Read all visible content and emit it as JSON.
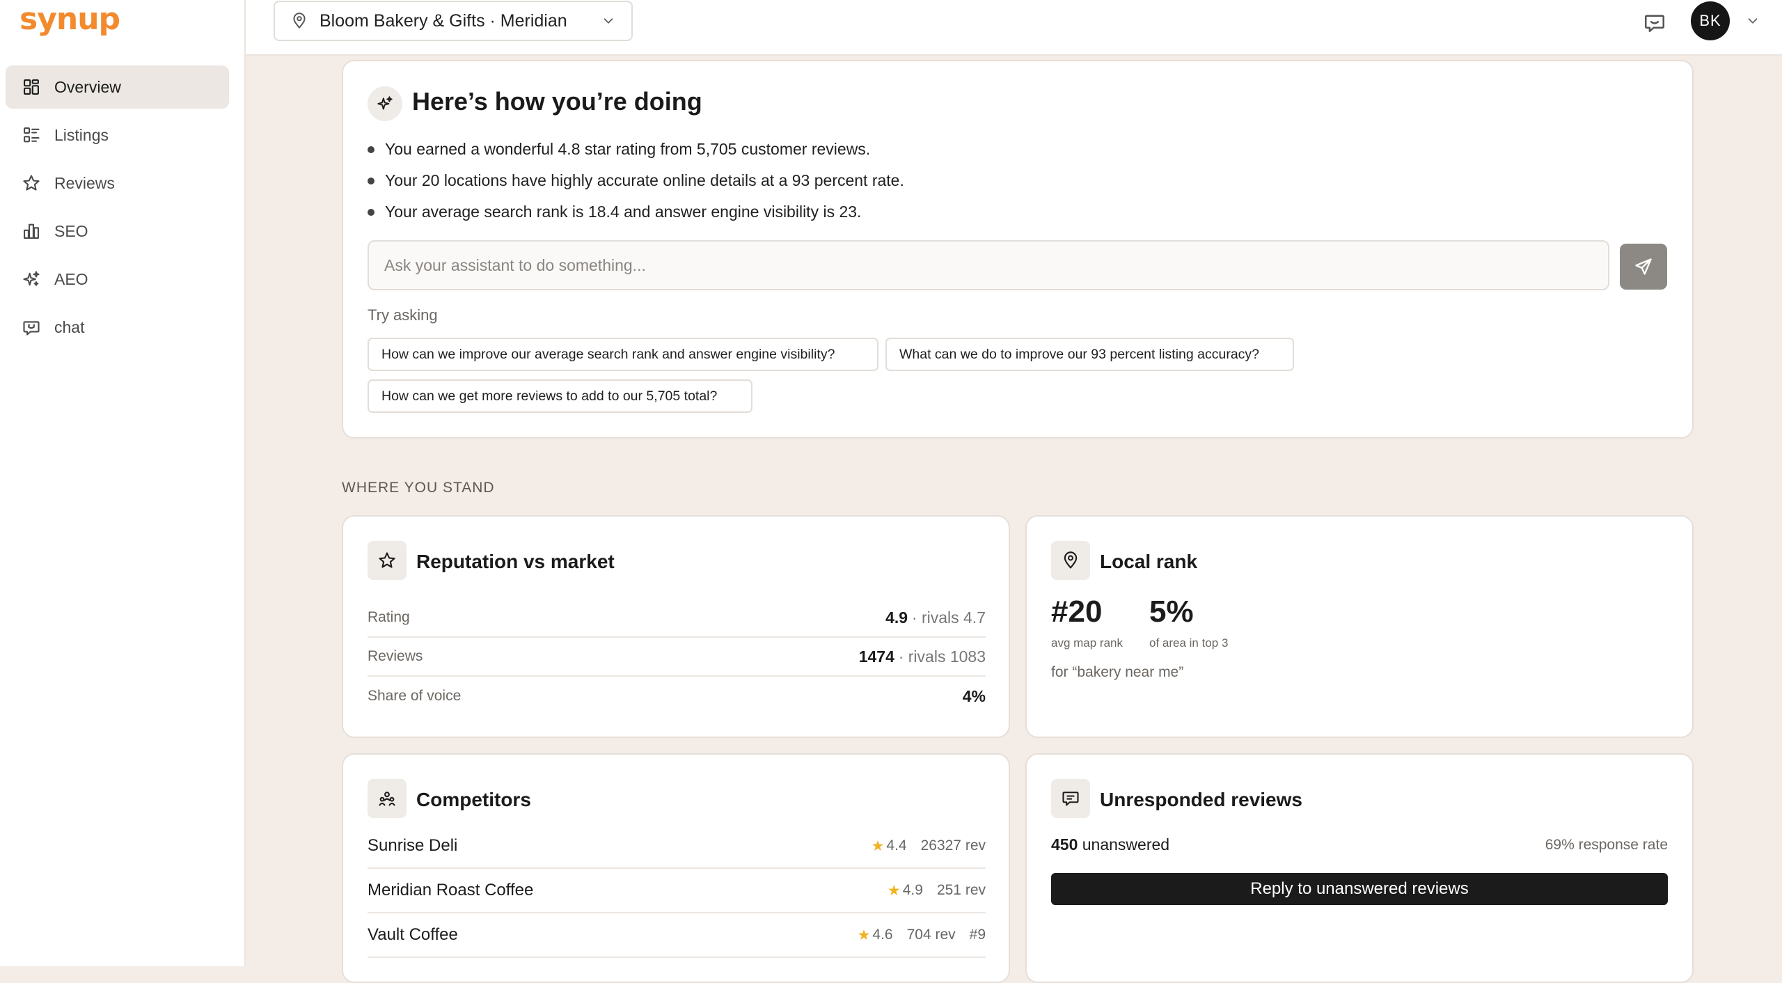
{
  "brand": {
    "logo_text": "synup",
    "accent_color": "#f28a2e"
  },
  "sidebar": {
    "items": [
      {
        "label": "Overview",
        "icon": "grid-icon",
        "active": true
      },
      {
        "label": "Listings",
        "icon": "list-icon",
        "active": false
      },
      {
        "label": "Reviews",
        "icon": "star-icon",
        "active": false
      },
      {
        "label": "SEO",
        "icon": "bar-chart-icon",
        "active": false
      },
      {
        "label": "AEO",
        "icon": "sparkle-icon",
        "active": false
      },
      {
        "label": "chat",
        "icon": "chat-icon",
        "active": false
      }
    ]
  },
  "topbar": {
    "location": "Bloom Bakery & Gifts · Meridian",
    "avatar_initials": "BK"
  },
  "summary": {
    "title": "Here’s how you’re doing",
    "bullets": [
      "You earned a wonderful 4.8 star rating from 5,705 customer reviews.",
      "Your 20 locations have highly accurate online details at a 93 percent rate.",
      "Your average search rank is 18.4 and answer engine visibility is 23."
    ],
    "ask_placeholder": "Ask your assistant to do something...",
    "try_label": "Try asking",
    "suggestions": [
      "How can we improve our average search rank and answer engine visibility?",
      "What can we do to improve our 93 percent listing accuracy?",
      "How can we get more reviews to add to our 5,705 total?"
    ]
  },
  "section_label": "WHERE YOU STAND",
  "reputation": {
    "title": "Reputation vs market",
    "rows": [
      {
        "label": "Rating",
        "value": "4.9",
        "rival": "· rivals 4.7"
      },
      {
        "label": "Reviews",
        "value": "1474",
        "rival": "· rivals 1083"
      },
      {
        "label": "Share of voice",
        "value": "4%",
        "rival": ""
      }
    ]
  },
  "local_rank": {
    "title": "Local rank",
    "rank": "#20",
    "rank_caption": "avg map rank",
    "top3": "5%",
    "top3_caption": "of area in top 3",
    "query": "for “bakery near me”"
  },
  "competitors": {
    "title": "Competitors",
    "rows": [
      {
        "name": "Sunrise Deli",
        "rating": "4.4",
        "reviews": "26327 rev",
        "rank": ""
      },
      {
        "name": "Meridian Roast Coffee",
        "rating": "4.9",
        "reviews": "251 rev",
        "rank": ""
      },
      {
        "name": "Vault Coffee",
        "rating": "4.6",
        "reviews": "704 rev",
        "rank": "#9"
      }
    ]
  },
  "unresponded": {
    "title": "Unresponded reviews",
    "count": "450",
    "count_suffix": " unanswered",
    "response_rate": "69% response rate",
    "button": "Reply to unanswered reviews"
  }
}
